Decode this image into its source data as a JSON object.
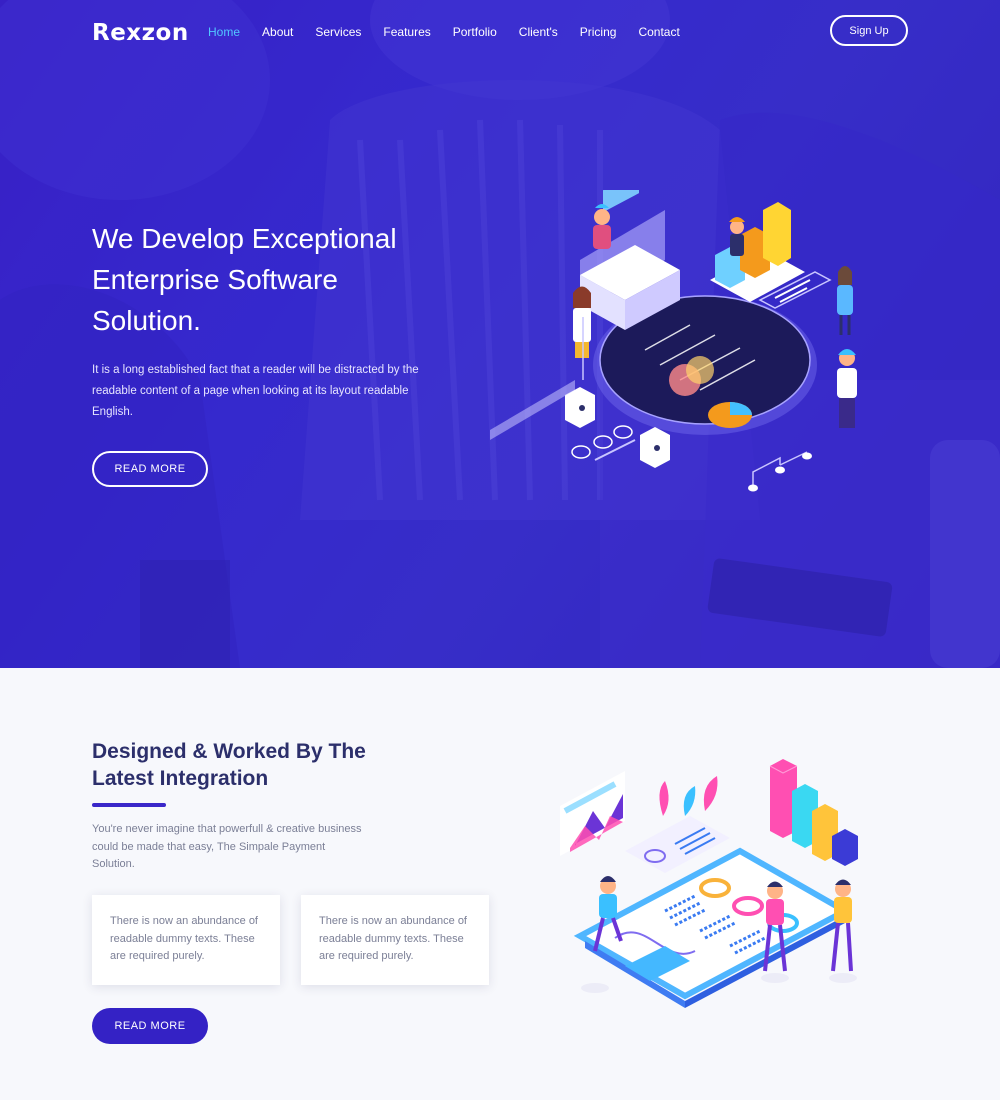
{
  "brand": {
    "logo": "Rexzon"
  },
  "nav": {
    "items": [
      {
        "label": "Home",
        "active": true
      },
      {
        "label": "About"
      },
      {
        "label": "Services"
      },
      {
        "label": "Features"
      },
      {
        "label": "Portfolio"
      },
      {
        "label": "Client's"
      },
      {
        "label": "Pricing"
      },
      {
        "label": "Contact"
      }
    ],
    "signup_label": "Sign Up"
  },
  "hero": {
    "title": "We Develop Exceptional Enterprise Software Solution.",
    "description": "It is a long established fact that a reader will be distracted by the readable content of a page when looking at its layout readable English.",
    "button_label": "READ MORE",
    "illustration_icon": "enterprise-dashboard-isometric-icon"
  },
  "section2": {
    "title": "Designed & Worked By The Latest Integration",
    "description": "You're never imagine that powerfull & creative business could be made that easy, The Simpale Payment Solution.",
    "cards": [
      {
        "text": "There is now an abundance of readable dummy texts. These are required purely."
      },
      {
        "text": "There is now an abundance of readable dummy texts. These are required purely."
      }
    ],
    "button_label": "READ MORE",
    "illustration_icon": "analytics-tablet-isometric-icon"
  },
  "colors": {
    "hero_bg": "#3a30d0",
    "accent": "#3422c5",
    "active_nav": "#52c6ff",
    "heading_dark": "#2c2f6b",
    "text_muted": "#7b7f96",
    "section_bg": "#f7f8fc"
  }
}
